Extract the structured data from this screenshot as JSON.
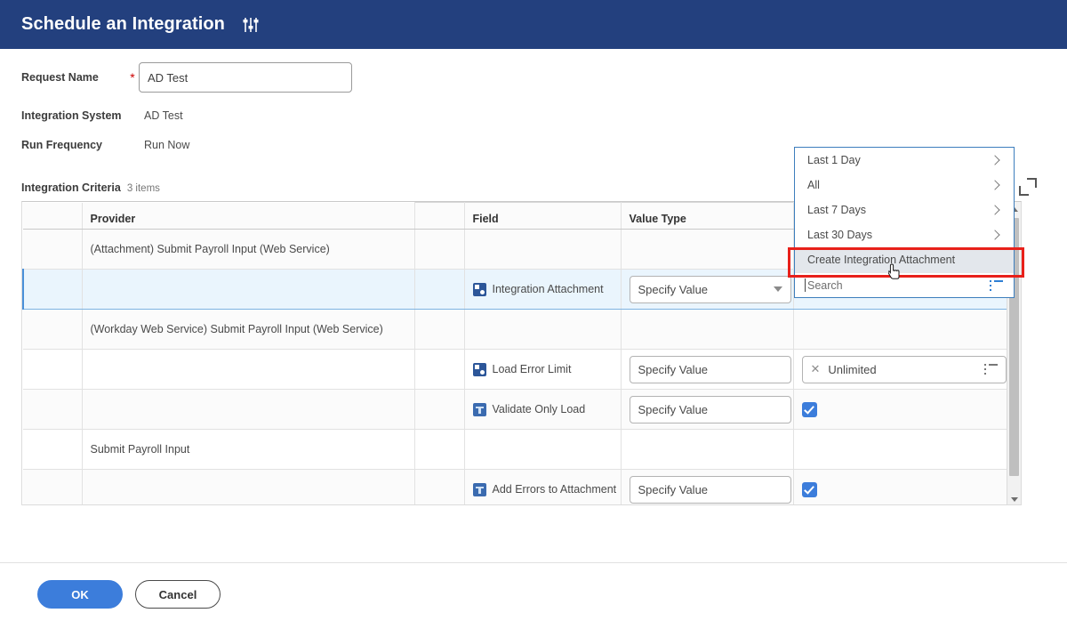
{
  "header": {
    "title": "Schedule an Integration",
    "icon": "sliders-settings-icon"
  },
  "form": {
    "request_name": {
      "label": "Request Name",
      "required_marker": "*",
      "value": "AD Test"
    },
    "integration_system": {
      "label": "Integration System",
      "value": "AD Test"
    },
    "run_frequency": {
      "label": "Run Frequency",
      "value": "Run Now"
    }
  },
  "grid": {
    "caption": "Integration Criteria",
    "count": "3 items",
    "columns": {
      "provider": "Provider",
      "field": "Field",
      "value_type": "Value Type"
    },
    "rows": [
      {
        "provider": "(Attachment) Submit Payroll Input (Web Service)",
        "field": "",
        "field_icon": "",
        "value_type": "",
        "value": "",
        "selected": false
      },
      {
        "provider": "",
        "field": "Integration Attachment",
        "field_icon": "reference-field-icon",
        "value_type": "Specify Value",
        "value": "",
        "selected": true
      },
      {
        "provider": "(Workday Web Service) Submit Payroll Input (Web Service)",
        "field": "",
        "field_icon": "",
        "value_type": "",
        "value": "",
        "selected": false
      },
      {
        "provider": "",
        "field": "Load Error Limit",
        "field_icon": "reference-field-icon",
        "value_type": "Specify Value",
        "value": "Unlimited",
        "selected": false
      },
      {
        "provider": "",
        "field": "Validate Only Load",
        "field_icon": "boolean-field-icon",
        "value_type": "Specify Value",
        "value": "checked",
        "selected": false
      },
      {
        "provider": "Submit Payroll Input",
        "field": "",
        "field_icon": "",
        "value_type": "",
        "value": "",
        "selected": false
      },
      {
        "provider": "",
        "field": "Add Errors to Attachment",
        "field_icon": "boolean-field-icon",
        "value_type": "Specify Value",
        "value": "checked",
        "selected": false
      }
    ]
  },
  "dropdown": {
    "items": [
      {
        "label": "Last 1 Day",
        "has_chevron": true,
        "highlighted": false
      },
      {
        "label": "All",
        "has_chevron": true,
        "highlighted": false
      },
      {
        "label": "Last 7 Days",
        "has_chevron": true,
        "highlighted": false
      },
      {
        "label": "Last 30 Days",
        "has_chevron": true,
        "highlighted": false
      },
      {
        "label": "Create Integration Attachment",
        "has_chevron": false,
        "highlighted": true
      }
    ],
    "search_placeholder": "Search",
    "highlight_border_color": "#e8201a"
  },
  "footer": {
    "ok_label": "OK",
    "cancel_label": "Cancel"
  },
  "colors": {
    "header_bg": "#23407e",
    "primary_button": "#3c7ddb",
    "selected_row": "#eaf5fd",
    "required_star": "#cc0000"
  }
}
